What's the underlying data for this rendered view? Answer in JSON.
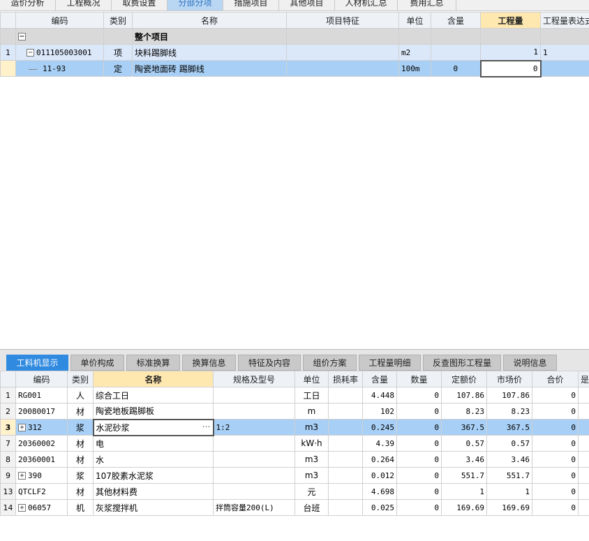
{
  "top_tabs": [
    "造价分析",
    "工程概况",
    "取费设置",
    "分部分项",
    "措施项目",
    "其他项目",
    "人材机汇总",
    "费用汇总"
  ],
  "upper_grid": {
    "headers": [
      "编码",
      "类别",
      "名称",
      "项目特征",
      "单位",
      "含量",
      "工程量",
      "工程量表达式"
    ],
    "group_row": {
      "sign": "−",
      "name": "整个项目"
    },
    "qd_row": {
      "num": "1",
      "sign": "−",
      "code": "011105003001",
      "type": "项",
      "name": "块料踢脚线",
      "unit": "m2",
      "qty": "1",
      "expr": "1"
    },
    "de_row": {
      "code": "11-93",
      "type": "定",
      "name": "陶瓷地面砖 踢脚线",
      "unit": "100m",
      "content": "0",
      "qty": "0"
    }
  },
  "bottom_tabs": [
    "工料机显示",
    "单价构成",
    "标准换算",
    "换算信息",
    "特征及内容",
    "组价方案",
    "工程量明细",
    "反查图形工程量",
    "说明信息"
  ],
  "lower_grid": {
    "headers": [
      "编码",
      "类别",
      "名称",
      "规格及型号",
      "单位",
      "损耗率",
      "含量",
      "数量",
      "定额价",
      "市场价",
      "合价",
      "是否"
    ],
    "rows": [
      {
        "num": "1",
        "code": "RG001",
        "type": "人",
        "name": "综合工日",
        "spec": "",
        "unit": "工日",
        "loss": "",
        "content": "4.448",
        "count": "0",
        "quota": "107.86",
        "market": "107.86",
        "total": "0"
      },
      {
        "num": "2",
        "code": "20080017",
        "type": "材",
        "name": "陶瓷地板踢脚板",
        "spec": "",
        "unit": "m",
        "loss": "",
        "content": "102",
        "count": "0",
        "quota": "8.23",
        "market": "8.23",
        "total": "0"
      },
      {
        "num": "3",
        "code": "312",
        "type": "浆",
        "name": "水泥砂浆",
        "spec": "1:2",
        "unit": "m3",
        "loss": "",
        "content": "0.245",
        "count": "0",
        "quota": "367.5",
        "market": "367.5",
        "total": "0"
      },
      {
        "num": "7",
        "code": "20360002",
        "type": "材",
        "name": "电",
        "spec": "",
        "unit": "kW·h",
        "loss": "",
        "content": "4.39",
        "count": "0",
        "quota": "0.57",
        "market": "0.57",
        "total": "0"
      },
      {
        "num": "8",
        "code": "20360001",
        "type": "材",
        "name": "水",
        "spec": "",
        "unit": "m3",
        "loss": "",
        "content": "0.264",
        "count": "0",
        "quota": "3.46",
        "market": "3.46",
        "total": "0"
      },
      {
        "num": "9",
        "code": "390",
        "type": "浆",
        "name": "107胶素水泥浆",
        "spec": "",
        "unit": "m3",
        "loss": "",
        "content": "0.012",
        "count": "0",
        "quota": "551.7",
        "market": "551.7",
        "total": "0"
      },
      {
        "num": "13",
        "code": "QTCLF2",
        "type": "材",
        "name": "其他材料费",
        "spec": "",
        "unit": "元",
        "loss": "",
        "content": "4.698",
        "count": "0",
        "quota": "1",
        "market": "1",
        "total": "0"
      },
      {
        "num": "14",
        "code": "06057",
        "type": "机",
        "name": "灰浆搅拌机",
        "spec": "拌筒容量200(L)",
        "unit": "台班",
        "loss": "",
        "content": "0.025",
        "count": "0",
        "quota": "169.69",
        "market": "169.69",
        "total": "0"
      }
    ]
  },
  "icons": {
    "expand": "plus-box-icon",
    "collapse": "minus-box-icon",
    "more": "ellipsis-icon"
  },
  "colors": {
    "active_tab": "#2f8ae0",
    "selected_row": "#a8cff5",
    "highlight_header": "#ffe8b0"
  }
}
